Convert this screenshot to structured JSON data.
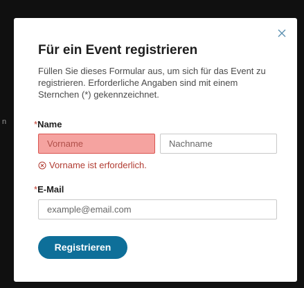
{
  "background": {
    "fragment_text": "n"
  },
  "dialog": {
    "title": "Für ein Event registrieren",
    "description": "Füllen Sie dieses Formular aus, um sich für das Event zu registrieren. Erforderliche Angaben sind mit einem Sternchen (*) gekennzeichnet.",
    "close_icon": "close-icon"
  },
  "form": {
    "name": {
      "required_marker": "*",
      "label": "Name",
      "first_name_placeholder": "Vorname",
      "last_name_placeholder": "Nachname",
      "error": "Vorname ist erforderlich."
    },
    "email": {
      "required_marker": "*",
      "label": "E-Mail",
      "placeholder": "example@email.com"
    },
    "submit_label": "Registrieren"
  },
  "colors": {
    "accent": "#0e6f99",
    "error": "#b03a30",
    "error_field_bg": "#f5a3a0"
  }
}
